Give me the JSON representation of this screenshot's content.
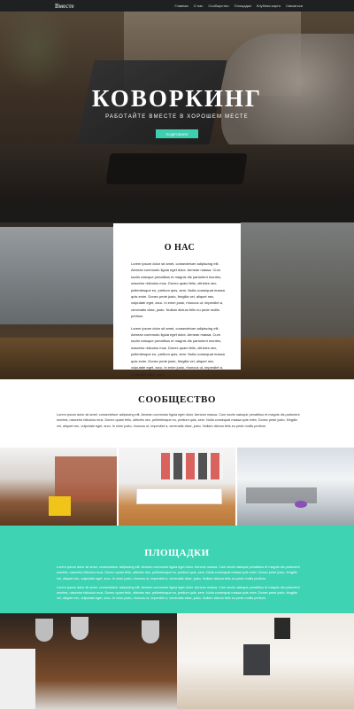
{
  "navbar": {
    "brand": "Вместе",
    "links": [
      "Главная",
      "О нас",
      "Сообщество",
      "Площадки",
      "Клубная карта",
      "Связаться"
    ]
  },
  "hero": {
    "title": "КОВОРКИНГ",
    "subtitle": "РАБОТАЙТЕ ВМЕСТЕ В ХОРОШЕМ МЕСТЕ",
    "button": "ПОДРОБНЕЕ"
  },
  "about": {
    "title": "О НАС",
    "paragraphs": [
      "Lorem ipsum dolor sit amet, consectetuer adipiscing elit. Aenean commodo ligula eget dolor. Aenean massa. Cum sociis natoque penatibus et magnis dis parturient montes, nascetur ridiculus mus. Donec quam felis, ultricies nec, pellentesque eu, pretium quis, sem. Nulla consequat massa quis enim. Donec pede justo, fringilla vel, aliquet nec, vulputate eget, arcu. In enim justo, rhoncus ut, imperdiet a, venenatis vitae, justo. Nullam dictum felis eu pede mollis pretium.",
      "Lorem ipsum dolor sit amet, consectetuer adipiscing elit. Aenean commodo ligula eget dolor. Aenean massa. Cum sociis natoque penatibus et magnis dis parturient montes, nascetur ridiculus mus. Donec quam felis, ultricies nec, pellentesque eu, pretium quis, sem. Nulla consequat massa quis enim. Donec pede justo, fringilla vel, aliquet nec, vulputate eget, arcu. In enim justo, rhoncus ut, imperdiet a, venenatis vitae, justo."
    ]
  },
  "community": {
    "title": "СООБЩЕСТВО",
    "text": "Lorem ipsum dolor sit amet, consectetuer adipiscing elit. Aenean commodo ligula eget dolor. Aenean massa. Cum sociis natoque penatibus et magnis dis parturient montes, nascetur ridiculus mus. Donec quam felis, ultricies nec, pellentesque eu, pretium quis, sem. Nulla consequat massa quis enim. Donec pede justo, fringilla vel, aliquet nec, vulputate eget, arcu. In enim justo, rhoncus ut, imperdiet a, venenatis vitae, justo. Nullam dictum felis eu pede mollis pretium."
  },
  "venues": {
    "title": "ПЛОЩАДКИ",
    "paragraphs": [
      "Lorem ipsum dolor sit amet, consectetuer adipiscing elit. Aenean commodo ligula eget dolor. Aenean massa. Cum sociis natoque penatibus et magnis dis parturient montes, nascetur ridiculus mus. Donec quam felis, ultricies nec, pellentesque eu, pretium quis, sem. Nulla consequat massa quis enim. Donec pede justo, fringilla vel, aliquet nec, vulputate eget, arcu. In enim justo, rhoncus ut, imperdiet a, venenatis vitae, justo. Nullam dictum felis eu pede mollis pretium.",
      "Lorem ipsum dolor sit amet, consectetuer adipiscing elit. Aenean commodo ligula eget dolor. Aenean massa. Cum sociis natoque penatibus et magnis dis parturient montes, nascetur ridiculus mus. Donec quam felis, ultricies nec, pellentesque eu, pretium quis, sem. Nulla consequat massa quis enim. Donec pede justo, fringilla vel, aliquet nec, vulputate eget, arcu. In enim justo, rhoncus ut, imperdiet a, venenatis vitae, justo. Nullam dictum felis eu pede mollis pretium."
    ]
  },
  "colors": {
    "navbar": "#1f2022",
    "accent": "#3ed3b3",
    "button": "#3ecfb0"
  }
}
